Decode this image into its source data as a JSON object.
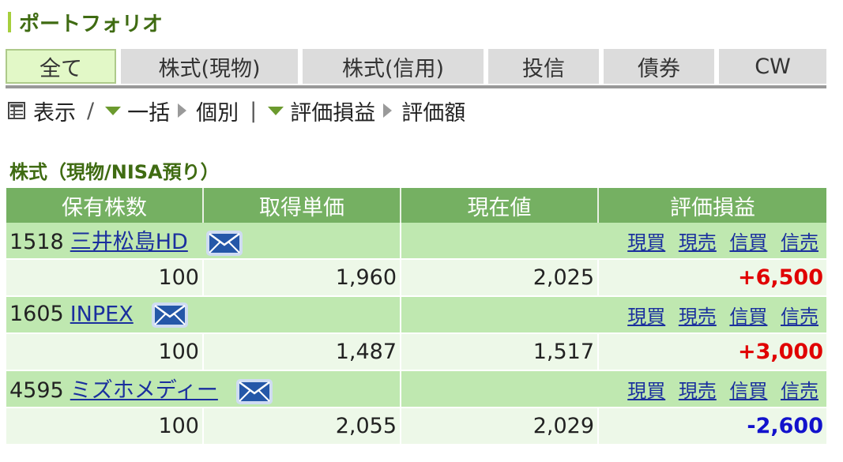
{
  "page": {
    "title": "ポートフォリオ"
  },
  "tabs": [
    {
      "label": "全て",
      "active": true
    },
    {
      "label": "株式(現物)",
      "active": false
    },
    {
      "label": "株式(信用)",
      "active": false
    },
    {
      "label": "投信",
      "active": false
    },
    {
      "label": "債券",
      "active": false
    },
    {
      "label": "CW",
      "active": false
    }
  ],
  "toolbar": {
    "display_label": "表示",
    "separator": "/",
    "bulk_label": "一括",
    "individual_label": "個別",
    "divider": "|",
    "gain_loss_label": "評価損益",
    "valuation_label": "評価額"
  },
  "section": {
    "title": "株式（現物/NISA預り）"
  },
  "table": {
    "headers": [
      "保有株数",
      "取得単価",
      "現在値",
      "評価損益"
    ],
    "actions": [
      "現買",
      "現売",
      "信買",
      "信売"
    ],
    "rows": [
      {
        "code": "1518",
        "name": "三井松島HD",
        "shares": "100",
        "cost": "1,960",
        "price": "2,025",
        "pl": "+6,500",
        "pl_sign": "gain"
      },
      {
        "code": "1605",
        "name": "INPEX",
        "shares": "100",
        "cost": "1,487",
        "price": "1,517",
        "pl": "+3,000",
        "pl_sign": "gain"
      },
      {
        "code": "4595",
        "name": "ミズホメディー",
        "shares": "100",
        "cost": "2,055",
        "price": "2,029",
        "pl": "-2,600",
        "pl_sign": "loss"
      }
    ]
  },
  "colors": {
    "gain": "#e00000",
    "loss": "#1212cc",
    "header_bg": "#75b062",
    "accent": "#3f6b12"
  }
}
